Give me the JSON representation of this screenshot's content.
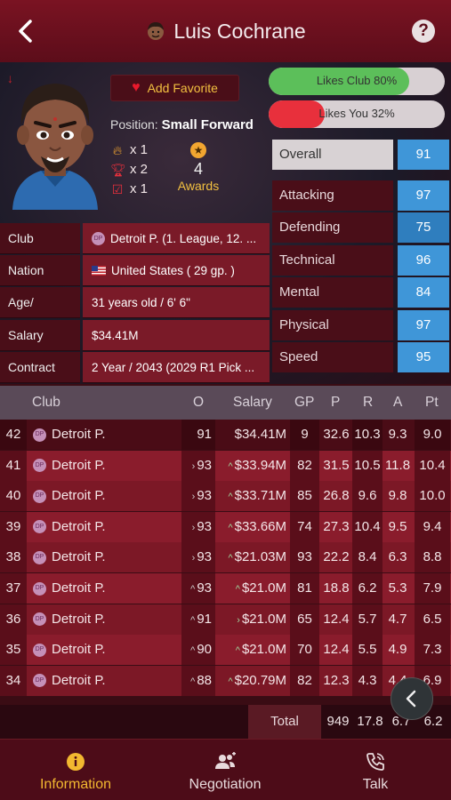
{
  "header": {
    "title": "Luis Cochrane"
  },
  "profile": {
    "favorite_label": "Add Favorite",
    "position_prefix": "Position:",
    "position_value": "Small Forward",
    "stats": [
      {
        "icon": "flame-icon",
        "count": "x 1"
      },
      {
        "icon": "trophy-icon",
        "count": "x 2"
      },
      {
        "icon": "checkbox-icon",
        "count": "x 1"
      }
    ],
    "awards_count": "4",
    "awards_label": "Awards"
  },
  "bars": [
    {
      "label": "Likes Club 80%",
      "value": 0.8,
      "color": "#5cbf5a"
    },
    {
      "label": "Likes You 32%",
      "value": 0.32,
      "color": "#e8303c"
    }
  ],
  "info": [
    {
      "key": "Club",
      "value": "Detroit P. (1. League, 12. ..."
    },
    {
      "key": "Nation",
      "value": "United States  ( 29 gp. )"
    },
    {
      "key": "Age/",
      "value": "31 years old / 6' 6\""
    },
    {
      "key": "Salary",
      "value": "$34.41M"
    },
    {
      "key": "Contract",
      "value": "2 Year / 2043   (2029 R1 Pick ..."
    }
  ],
  "ratings": [
    {
      "name": "Overall",
      "value": "91"
    },
    {
      "name": "Attacking",
      "value": "97"
    },
    {
      "name": "Defending",
      "value": "75"
    },
    {
      "name": "Technical",
      "value": "96"
    },
    {
      "name": "Mental",
      "value": "84"
    },
    {
      "name": "Physical",
      "value": "97"
    },
    {
      "name": "Speed",
      "value": "95"
    }
  ],
  "career": {
    "headers": {
      "club": "Club",
      "o": "O",
      "salary": "Salary",
      "gp": "GP",
      "p": "P",
      "r": "R",
      "a": "A",
      "pt": "Pt"
    },
    "rows": [
      {
        "season": "42",
        "club": "Detroit P.",
        "o": "91",
        "o_arrow": "",
        "salary": "$34.41M",
        "salary_arrow": "",
        "gp": "9",
        "p": "32.6",
        "r": "10.3",
        "a": "9.3",
        "pt": "9.0"
      },
      {
        "season": "41",
        "club": "Detroit P.",
        "o": "93",
        "o_arrow": "›",
        "salary": "$33.94M",
        "salary_arrow": "^",
        "gp": "82",
        "p": "31.5",
        "r": "10.5",
        "a": "11.8",
        "pt": "10.4"
      },
      {
        "season": "40",
        "club": "Detroit P.",
        "o": "93",
        "o_arrow": "›",
        "salary": "$33.71M",
        "salary_arrow": "^",
        "gp": "85",
        "p": "26.8",
        "r": "9.6",
        "a": "9.8",
        "pt": "10.0"
      },
      {
        "season": "39",
        "club": "Detroit P.",
        "o": "93",
        "o_arrow": "›",
        "salary": "$33.66M",
        "salary_arrow": "^",
        "gp": "74",
        "p": "27.3",
        "r": "10.4",
        "a": "9.5",
        "pt": "9.4"
      },
      {
        "season": "38",
        "club": "Detroit P.",
        "o": "93",
        "o_arrow": "›",
        "salary": "$21.03M",
        "salary_arrow": "^",
        "gp": "93",
        "p": "22.2",
        "r": "8.4",
        "a": "6.3",
        "pt": "8.8"
      },
      {
        "season": "37",
        "club": "Detroit P.",
        "o": "93",
        "o_arrow": "^",
        "salary": "$21.0M",
        "salary_arrow": "^",
        "gp": "81",
        "p": "18.8",
        "r": "6.2",
        "a": "5.3",
        "pt": "7.9"
      },
      {
        "season": "36",
        "club": "Detroit P.",
        "o": "91",
        "o_arrow": "^",
        "salary": "$21.0M",
        "salary_arrow": "›",
        "gp": "65",
        "p": "12.4",
        "r": "5.7",
        "a": "4.7",
        "pt": "6.5"
      },
      {
        "season": "35",
        "club": "Detroit P.",
        "o": "90",
        "o_arrow": "^",
        "salary": "$21.0M",
        "salary_arrow": "^",
        "gp": "70",
        "p": "12.4",
        "r": "5.5",
        "a": "4.9",
        "pt": "7.3"
      },
      {
        "season": "34",
        "club": "Detroit P.",
        "o": "88",
        "o_arrow": "^",
        "salary": "$20.79M",
        "salary_arrow": "^",
        "gp": "82",
        "p": "12.3",
        "r": "4.3",
        "a": "4.4",
        "pt": "6.9"
      }
    ],
    "total": {
      "label": "Total",
      "gp": "949",
      "p": "17.8",
      "r": "6.7",
      "a": "6.2"
    }
  },
  "nav": [
    {
      "label": "Information",
      "icon": "info-icon"
    },
    {
      "label": "Negotiation",
      "icon": "users-icon"
    },
    {
      "label": "Talk",
      "icon": "phone-icon"
    }
  ],
  "colors": {
    "accent": "#f2b830",
    "rating_blue": "#3f96d8",
    "header": "#7a1322"
  }
}
